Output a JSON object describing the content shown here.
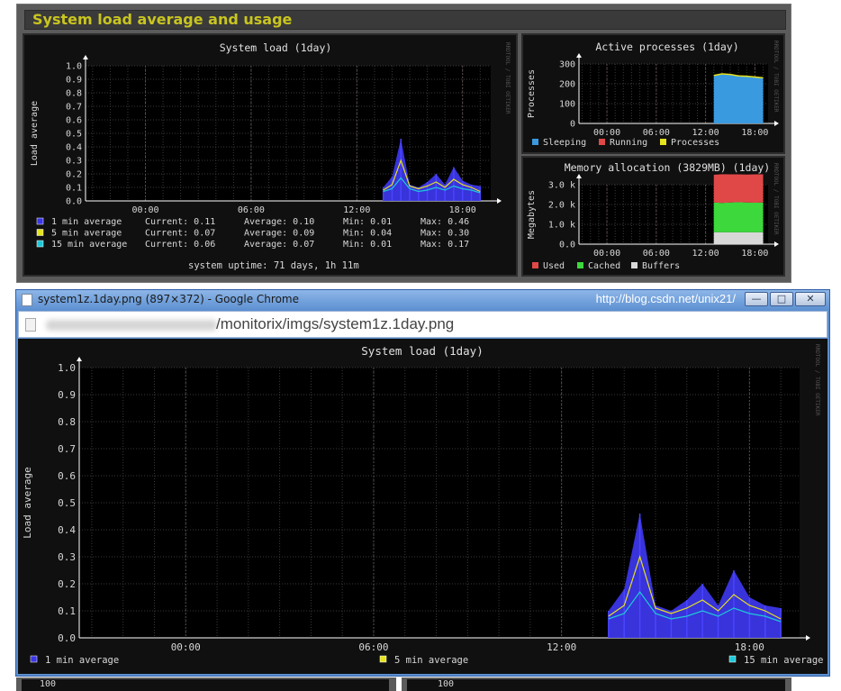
{
  "dashboard": {
    "title": "System load average and usage",
    "load": {
      "title": "System load   (1day)",
      "ylabel": "Load average",
      "side_label": "RRDTOOL / TOBI OETIKER",
      "yticks": [
        "1.0",
        "0.9",
        "0.8",
        "0.7",
        "0.6",
        "0.5",
        "0.4",
        "0.3",
        "0.2",
        "0.1",
        "0.0"
      ],
      "xticks": [
        "00:00",
        "06:00",
        "12:00",
        "18:00"
      ],
      "legend": [
        {
          "label": "1 min average",
          "color": "#3b36e6",
          "current": "Current: 0.11",
          "average": "Average: 0.10",
          "min": "Min: 0.01",
          "max": "Max: 0.46"
        },
        {
          "label": "5 min average",
          "color": "#e6e21e",
          "current": "Current: 0.07",
          "average": "Average: 0.09",
          "min": "Min: 0.04",
          "max": "Max: 0.30"
        },
        {
          "label": "15 min average",
          "color": "#1ec8d8",
          "current": "Current: 0.06",
          "average": "Average: 0.07",
          "min": "Min: 0.01",
          "max": "Max: 0.17"
        }
      ],
      "uptime": "system uptime: 71 days, 1h 11m"
    },
    "processes": {
      "title": "Active processes   (1day)",
      "ylabel": "Processes",
      "side_label": "RRDTOOL / TOBI OETIKER",
      "yticks": [
        "300",
        "200",
        "100",
        "0"
      ],
      "xticks": [
        "00:00",
        "06:00",
        "12:00",
        "18:00"
      ],
      "legend": [
        {
          "label": "Sleeping",
          "color": "#3a9ae0"
        },
        {
          "label": "Running",
          "color": "#e04848"
        },
        {
          "label": "Processes",
          "color": "#e6e21e"
        }
      ]
    },
    "memory": {
      "title": "Memory allocation (3829MB)   (1day)",
      "ylabel": "Megabytes",
      "side_label": "RRDTOOL / TOBI OETIKER",
      "yticks": [
        "3.0 k",
        "2.0 k",
        "1.0 k",
        "0.0"
      ],
      "xticks": [
        "00:00",
        "06:00",
        "12:00",
        "18:00"
      ],
      "legend": [
        {
          "label": "Used",
          "color": "#e04848"
        },
        {
          "label": "Cached",
          "color": "#3cd83c"
        },
        {
          "label": "Buffers",
          "color": "#d8d8d8"
        }
      ]
    },
    "bottom_ticks": [
      "100",
      "100"
    ]
  },
  "browser": {
    "window_title": "system1z.1day.png (897×372) - Google Chrome",
    "overlay_url": "http://blog.csdn.net/unix21/",
    "buttons": {
      "minimize": "—",
      "maximize": "□",
      "close": "✕"
    },
    "address": "/monitorix/imgs/system1z.1day.png",
    "image": {
      "title": "System load   (1day)",
      "ylabel": "Load average",
      "side_label": "RRDTOOL / TOBI OETIKER",
      "yticks": [
        "1.0",
        "0.9",
        "0.8",
        "0.7",
        "0.6",
        "0.5",
        "0.4",
        "0.3",
        "0.2",
        "0.1",
        "0.0"
      ],
      "xticks": [
        "00:00",
        "06:00",
        "12:00",
        "18:00"
      ],
      "legend": [
        "1 min average",
        "5 min average",
        "15 min average"
      ]
    }
  },
  "colors": {
    "grid": "#3a3a3a",
    "axis": "#ffffff",
    "plot_bg": "#000000",
    "panel_bg": "#101010"
  },
  "chart_data": [
    {
      "type": "area",
      "title": "System load   (1day)",
      "ylabel": "Load average",
      "xlabel": "",
      "ylim": [
        0,
        1.0
      ],
      "x": [
        "13:30",
        "14:00",
        "14:30",
        "15:00",
        "15:30",
        "16:00",
        "16:30",
        "17:00",
        "17:30",
        "18:00",
        "18:30",
        "19:00"
      ],
      "series": [
        {
          "name": "1 min average",
          "values": [
            0.1,
            0.18,
            0.46,
            0.12,
            0.1,
            0.14,
            0.2,
            0.12,
            0.25,
            0.15,
            0.12,
            0.11
          ]
        },
        {
          "name": "5 min average",
          "values": [
            0.08,
            0.12,
            0.3,
            0.11,
            0.09,
            0.11,
            0.14,
            0.1,
            0.16,
            0.12,
            0.1,
            0.07
          ]
        },
        {
          "name": "15 min average",
          "values": [
            0.07,
            0.09,
            0.17,
            0.09,
            0.07,
            0.08,
            0.1,
            0.08,
            0.11,
            0.09,
            0.08,
            0.06
          ]
        }
      ]
    },
    {
      "type": "area",
      "title": "Active processes   (1day)",
      "ylabel": "Processes",
      "ylim": [
        0,
        300
      ],
      "x": [
        "13:00",
        "14:00",
        "15:00",
        "16:00",
        "17:00",
        "18:00",
        "19:00"
      ],
      "series": [
        {
          "name": "Sleeping",
          "values": [
            240,
            248,
            245,
            238,
            236,
            232,
            228
          ]
        },
        {
          "name": "Running",
          "values": [
            1,
            1,
            1,
            1,
            1,
            1,
            1
          ]
        },
        {
          "name": "Processes",
          "values": [
            242,
            250,
            247,
            240,
            238,
            234,
            230
          ]
        }
      ]
    },
    {
      "type": "area",
      "title": "Memory allocation (3829MB)   (1day)",
      "ylabel": "Megabytes",
      "ylim": [
        0,
        4000
      ],
      "x": [
        "13:00",
        "14:00",
        "15:00",
        "16:00",
        "17:00",
        "18:00",
        "19:00"
      ],
      "series": [
        {
          "name": "Used",
          "values": [
            1400,
            1450,
            1420,
            1400,
            1410,
            1430,
            1420
          ]
        },
        {
          "name": "Cached",
          "values": [
            1500,
            1480,
            1500,
            1520,
            1500,
            1490,
            1500
          ]
        },
        {
          "name": "Buffers",
          "values": [
            600,
            600,
            600,
            600,
            600,
            600,
            600
          ]
        }
      ]
    }
  ]
}
